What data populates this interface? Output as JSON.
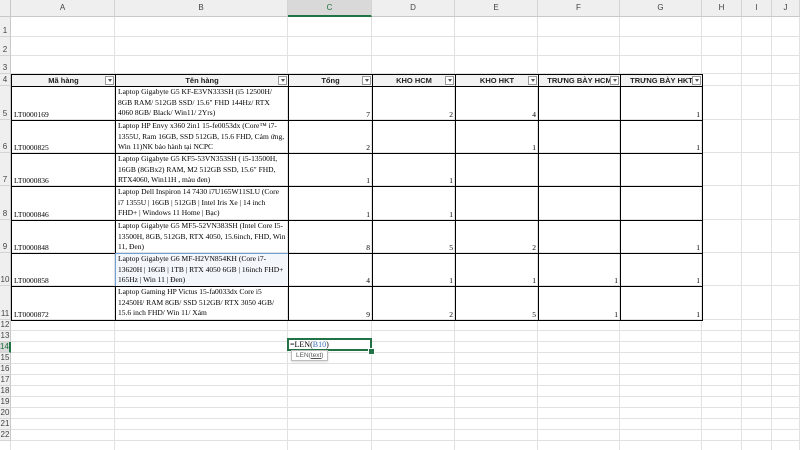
{
  "columns": [
    "A",
    "B",
    "C",
    "D",
    "E",
    "F",
    "G",
    "H",
    "I",
    "J"
  ],
  "selected_column": "C",
  "rows": [
    "1",
    "2",
    "3",
    "4",
    "5",
    "6",
    "7",
    "8",
    "9",
    "10",
    "11",
    "12",
    "13",
    "14",
    "15",
    "16",
    "17",
    "18",
    "19",
    "20",
    "21",
    "22"
  ],
  "selected_row": "14",
  "table": {
    "headers": [
      "Mã hàng",
      "Tên hàng",
      "Tổng",
      "KHO HCM",
      "KHO HKT",
      "TRƯNG BÀY HCM",
      "TRƯNG BÀY HKT"
    ],
    "rows": [
      {
        "code": "LT0000169",
        "name": "Laptop Gigabyte G5 KF-E3VN333SH (i5 12500H/ 8GB RAM/ 512GB SSD/ 15.6\" FHD 144Hz/ RTX 4060 8GB/ Black/ Win11/ 2Yrs)",
        "total": "7",
        "kho_hcm": "2",
        "kho_hkt": "4",
        "tb_hcm": "",
        "tb_hkt": "1"
      },
      {
        "code": "LT0000825",
        "name": "Laptop HP Envy x360 2in1 15-fe0053dx (Core™ i7-1355U, Ram 16GB, SSD 512GB, 15.6 FHD, Cảm ứng, Win 11)NK bảo hành tại NCPC",
        "total": "2",
        "kho_hcm": "",
        "kho_hkt": "1",
        "tb_hcm": "",
        "tb_hkt": "1"
      },
      {
        "code": "LT0000836",
        "name": "Laptop Gigabyte G5 KF5-53VN353SH ( i5-13500H, 16GB (8GBx2) RAM, M2 512GB SSD, 15.6\" FHD, RTX4060, Win11H , màu đen)",
        "total": "1",
        "kho_hcm": "1",
        "kho_hkt": "",
        "tb_hcm": "",
        "tb_hkt": ""
      },
      {
        "code": "LT0000846",
        "name": "Laptop Dell Inspiron 14 7430 i7U165W11SLU (Core i7 1355U | 16GB | 512GB | Intel Iris Xe | 14 inch FHD+ | Windows 11 Home | Bạc)",
        "total": "1",
        "kho_hcm": "1",
        "kho_hkt": "",
        "tb_hcm": "",
        "tb_hkt": ""
      },
      {
        "code": "LT0000848",
        "name": "Laptop Gigabyte G5 MF5-52VN383SH (Intel Core I5-13500H, 8GB, 512GB, RTX 4050, 15.6inch, FHD, Win 11, Đen)",
        "total": "8",
        "kho_hcm": "5",
        "kho_hkt": "2",
        "tb_hcm": "",
        "tb_hkt": "1"
      },
      {
        "code": "LT0000858",
        "name": "Laptop Gigabyte G6 MF-H2VN854KH (Core i7-13620H | 16GB | 1TB | RTX 4050 6GB | 16inch FHD+ 165Hz | Win 11 | Đen)",
        "total": "4",
        "kho_hcm": "1",
        "kho_hkt": "1",
        "tb_hcm": "1",
        "tb_hkt": "1"
      },
      {
        "code": "LT0000872",
        "name": "Laptop Gaming HP Victus 15-fa0033dx Core i5 12450H/ RAM 8GB/ SSD 512GB/ RTX 3050 4GB/ 15.6 inch FHD/ Win 11/ Xám",
        "total": "9",
        "kho_hcm": "2",
        "kho_hkt": "5",
        "tb_hcm": "1",
        "tb_hkt": "1"
      }
    ]
  },
  "formula_cell": {
    "prefix": "=LEN(",
    "ref": "B10",
    "suffix": ")"
  },
  "tooltip": {
    "func": "LEN(",
    "arg": "text",
    "close": ")"
  }
}
